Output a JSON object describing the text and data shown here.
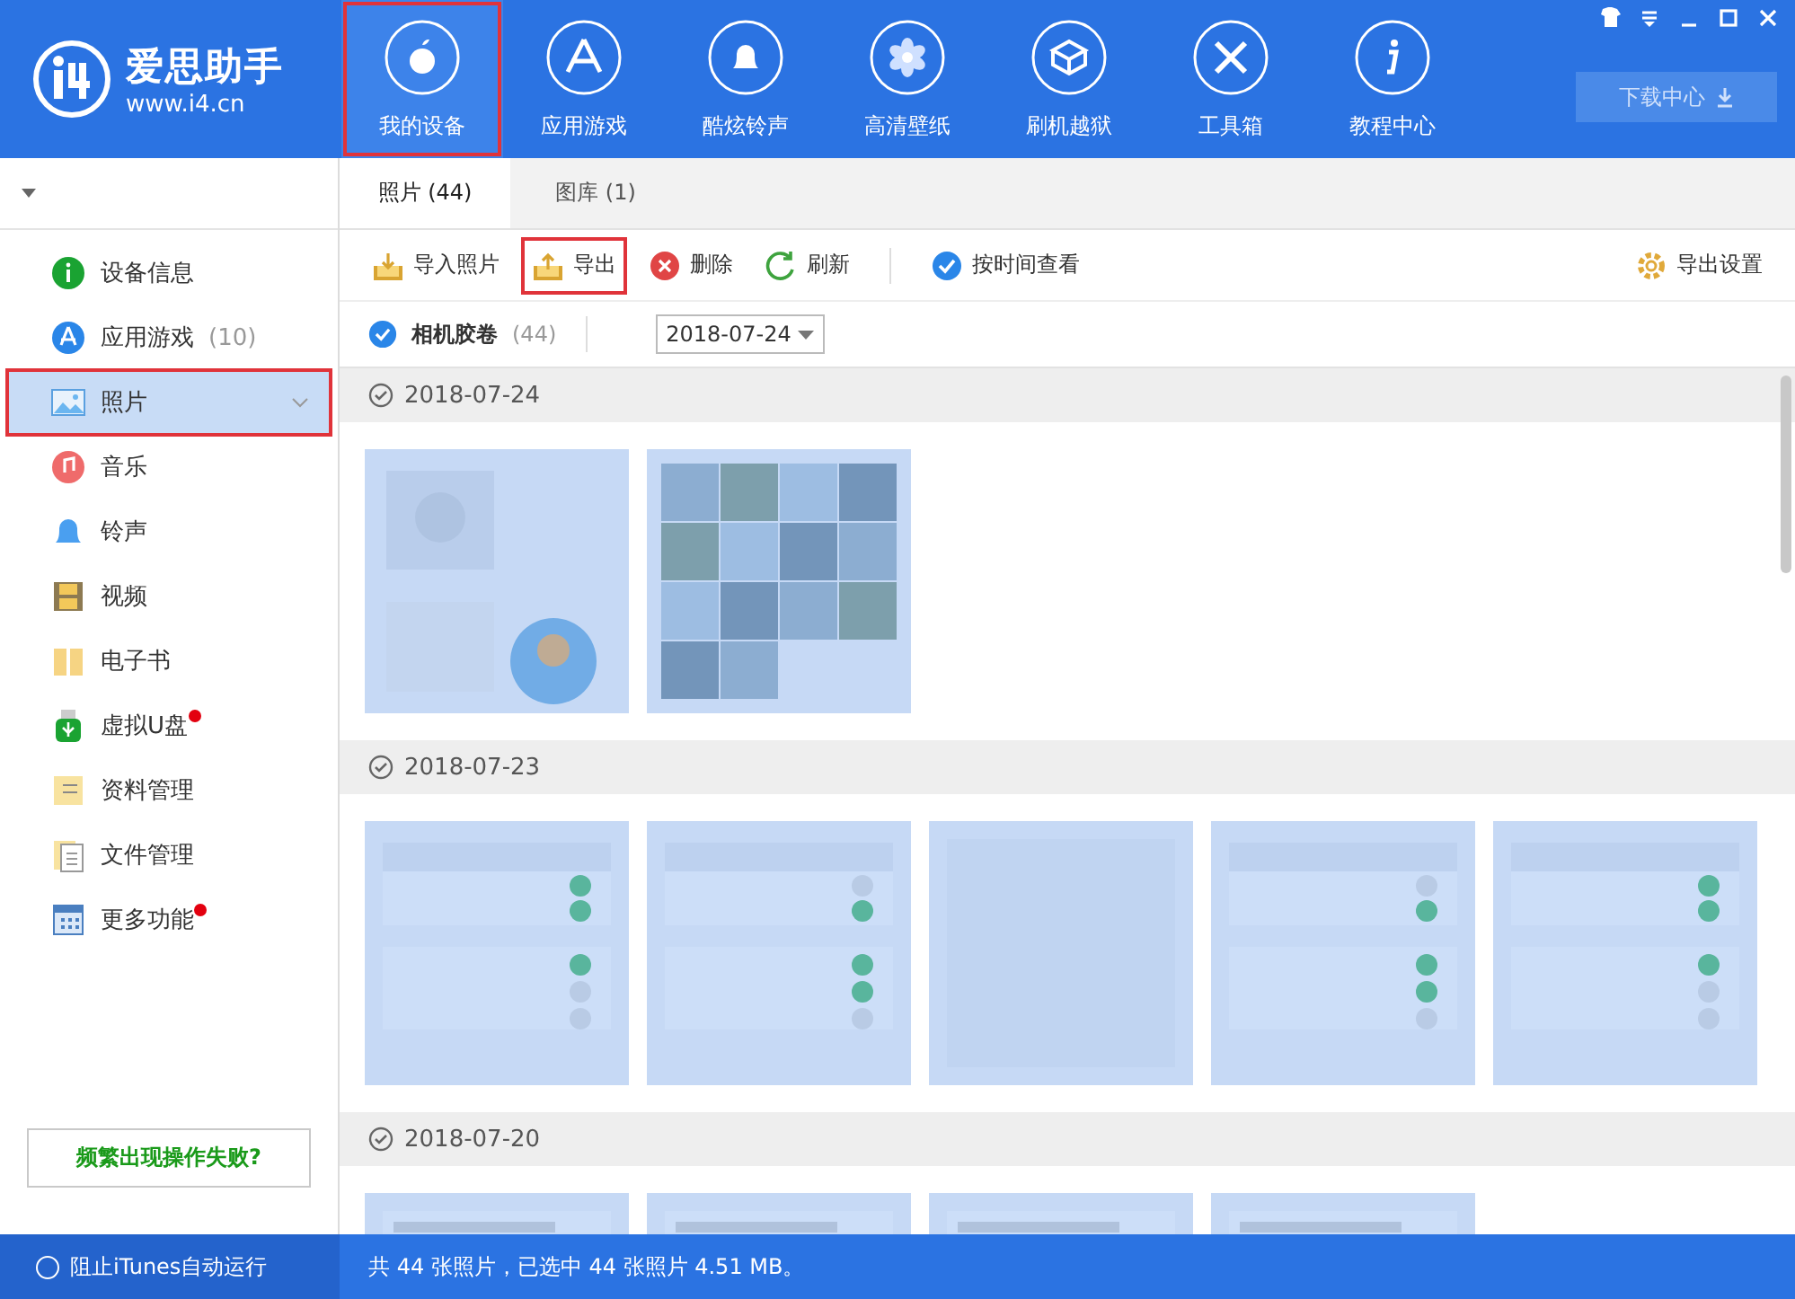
{
  "app": {
    "name": "爱思助手",
    "url": "www.i4.cn"
  },
  "nav": [
    {
      "label": "我的设备",
      "selected": true,
      "highlighted": true
    },
    {
      "label": "应用游戏",
      "selected": false,
      "highlighted": false
    },
    {
      "label": "酷炫铃声",
      "selected": false,
      "highlighted": false
    },
    {
      "label": "高清壁纸",
      "selected": false,
      "highlighted": false
    },
    {
      "label": "刷机越狱",
      "selected": false,
      "highlighted": false
    },
    {
      "label": "工具箱",
      "selected": false,
      "highlighted": false
    },
    {
      "label": "教程中心",
      "selected": false,
      "highlighted": false
    }
  ],
  "download_button": "下载中心",
  "sidebar": {
    "items": [
      {
        "label": "设备信息",
        "badge": false,
        "selected": false,
        "highlighted": false
      },
      {
        "label": "应用游戏",
        "count": "(10)",
        "badge": false,
        "selected": false,
        "highlighted": false
      },
      {
        "label": "照片",
        "badge": false,
        "selected": true,
        "highlighted": true
      },
      {
        "label": "音乐",
        "badge": false,
        "selected": false,
        "highlighted": false
      },
      {
        "label": "铃声",
        "badge": false,
        "selected": false,
        "highlighted": false
      },
      {
        "label": "视频",
        "badge": false,
        "selected": false,
        "highlighted": false
      },
      {
        "label": "电子书",
        "badge": false,
        "selected": false,
        "highlighted": false
      },
      {
        "label": "虚拟U盘",
        "badge": true,
        "selected": false,
        "highlighted": false
      },
      {
        "label": "资料管理",
        "badge": false,
        "selected": false,
        "highlighted": false
      },
      {
        "label": "文件管理",
        "badge": false,
        "selected": false,
        "highlighted": false
      },
      {
        "label": "更多功能",
        "badge": true,
        "selected": false,
        "highlighted": false
      }
    ],
    "help_button": "频繁出现操作失败?"
  },
  "tabs": [
    {
      "label": "照片 (44)",
      "selected": true
    },
    {
      "label": "图库 (1)",
      "selected": false
    }
  ],
  "toolbar": [
    {
      "label": "导入照片",
      "highlighted": false
    },
    {
      "label": "导出",
      "highlighted": true
    },
    {
      "label": "删除",
      "highlighted": false
    },
    {
      "label": "刷新",
      "highlighted": false
    },
    {
      "label": "按时间查看",
      "highlighted": false
    }
  ],
  "export_settings": "导出设置",
  "filter": {
    "album": "相机胶卷",
    "checked": true,
    "count": "(44)",
    "date": "2018-07-24"
  },
  "groups": [
    {
      "date": "2018-07-24",
      "photos": [
        {
          "kind": "picture",
          "selected": true
        },
        {
          "kind": "picture",
          "selected": true
        }
      ]
    },
    {
      "date": "2018-07-23",
      "photos": [
        {
          "kind": "picture",
          "selected": true
        },
        {
          "kind": "picture",
          "selected": true
        },
        {
          "kind": "picture",
          "selected": true
        },
        {
          "kind": "picture",
          "selected": true
        },
        {
          "kind": "picture",
          "selected": true
        }
      ]
    },
    {
      "date": "2018-07-20",
      "photos": [
        {
          "kind": "picture",
          "selected": true
        },
        {
          "kind": "picture",
          "selected": true
        },
        {
          "kind": "picture",
          "selected": true
        },
        {
          "kind": "picture",
          "selected": true
        }
      ]
    }
  ],
  "status_bar": {
    "itunes_toggle": {
      "label": "阻止iTunes自动运行",
      "checked": false
    },
    "summary": "共 44 张照片，已选中 44 张照片 4.51 MB。"
  }
}
